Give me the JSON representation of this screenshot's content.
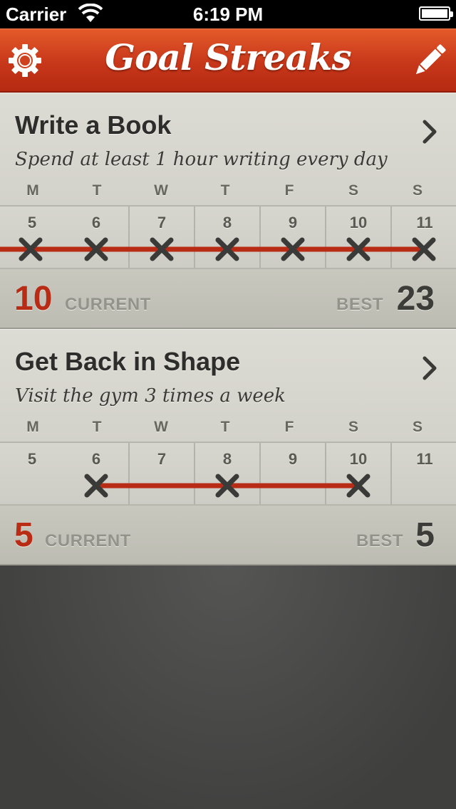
{
  "status_bar": {
    "carrier": "Carrier",
    "time": "6:19 PM"
  },
  "nav": {
    "title": "Goal Streaks",
    "settings_icon": "gear-icon",
    "edit_icon": "pencil-icon"
  },
  "colors": {
    "accent": "#c7371a",
    "streak": "#b82b14",
    "mark": "#3a3a38"
  },
  "goals": [
    {
      "title": "Write a Book",
      "description": "Spend at least 1 hour writing every day",
      "days": [
        {
          "letter": "M",
          "date": "5",
          "done": true
        },
        {
          "letter": "T",
          "date": "6",
          "done": true
        },
        {
          "letter": "W",
          "date": "7",
          "done": true
        },
        {
          "letter": "T",
          "date": "8",
          "done": true
        },
        {
          "letter": "F",
          "date": "9",
          "done": true
        },
        {
          "letter": "S",
          "date": "10",
          "done": true
        },
        {
          "letter": "S",
          "date": "11",
          "done": true
        }
      ],
      "streak_extends_left": true,
      "current": "10",
      "current_label": "CURRENT",
      "best_label": "BEST",
      "best": "23"
    },
    {
      "title": "Get Back in Shape",
      "description": "Visit the gym 3 times a week",
      "days": [
        {
          "letter": "M",
          "date": "5",
          "done": false
        },
        {
          "letter": "T",
          "date": "6",
          "done": true
        },
        {
          "letter": "W",
          "date": "7",
          "done": false
        },
        {
          "letter": "T",
          "date": "8",
          "done": true
        },
        {
          "letter": "F",
          "date": "9",
          "done": false
        },
        {
          "letter": "S",
          "date": "10",
          "done": true
        },
        {
          "letter": "S",
          "date": "11",
          "done": false
        }
      ],
      "streak_extends_left": false,
      "current": "5",
      "current_label": "CURRENT",
      "best_label": "BEST",
      "best": "5"
    }
  ]
}
